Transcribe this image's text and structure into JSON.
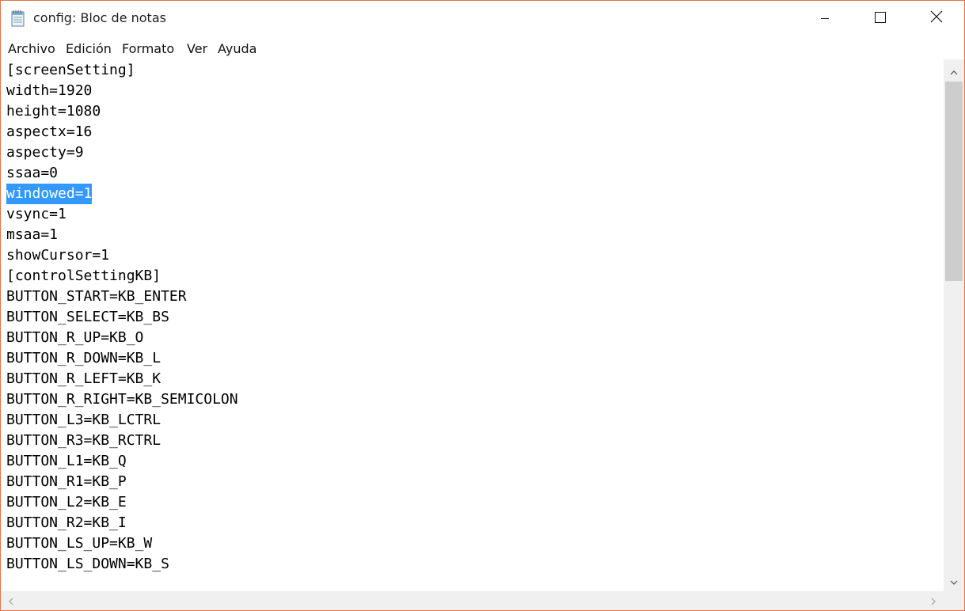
{
  "window": {
    "title": "config: Bloc de notas",
    "icon": "notepad-icon",
    "controls": [
      "minimize-icon",
      "maximize-icon",
      "close-icon"
    ]
  },
  "menu": [
    "Archivo",
    "Edición",
    "Formato",
    "Ver",
    "Ayuda"
  ],
  "editor": {
    "lines": [
      "[screenSetting]",
      "width=1920",
      "height=1080",
      "aspectx=16",
      "aspecty=9",
      "ssaa=0",
      "windowed=1",
      "vsync=1",
      "msaa=1",
      "showCursor=1",
      "[controlSettingKB]",
      "BUTTON_START=KB_ENTER",
      "BUTTON_SELECT=KB_BS",
      "BUTTON_R_UP=KB_O",
      "BUTTON_R_DOWN=KB_L",
      "BUTTON_R_LEFT=KB_K",
      "BUTTON_R_RIGHT=KB_SEMICOLON",
      "BUTTON_L3=KB_LCTRL",
      "BUTTON_R3=KB_RCTRL",
      "BUTTON_L1=KB_Q",
      "BUTTON_R1=KB_P",
      "BUTTON_L2=KB_E",
      "BUTTON_R2=KB_I",
      "BUTTON_LS_UP=KB_W",
      "BUTTON_LS_DOWN=KB_S"
    ],
    "selected_line": "windowed=1",
    "selection_color": "#3399ff"
  },
  "scrollbars": {
    "vertical": {
      "up": "chevron-up-icon",
      "down": "chevron-down-icon"
    },
    "horizontal": {
      "left": "chevron-left-icon",
      "right": "chevron-right-icon"
    }
  },
  "colors": {
    "window_border": "#e2754a",
    "scrollbar_track": "#f0f0f0",
    "scrollbar_thumb": "#cdcdcd"
  }
}
